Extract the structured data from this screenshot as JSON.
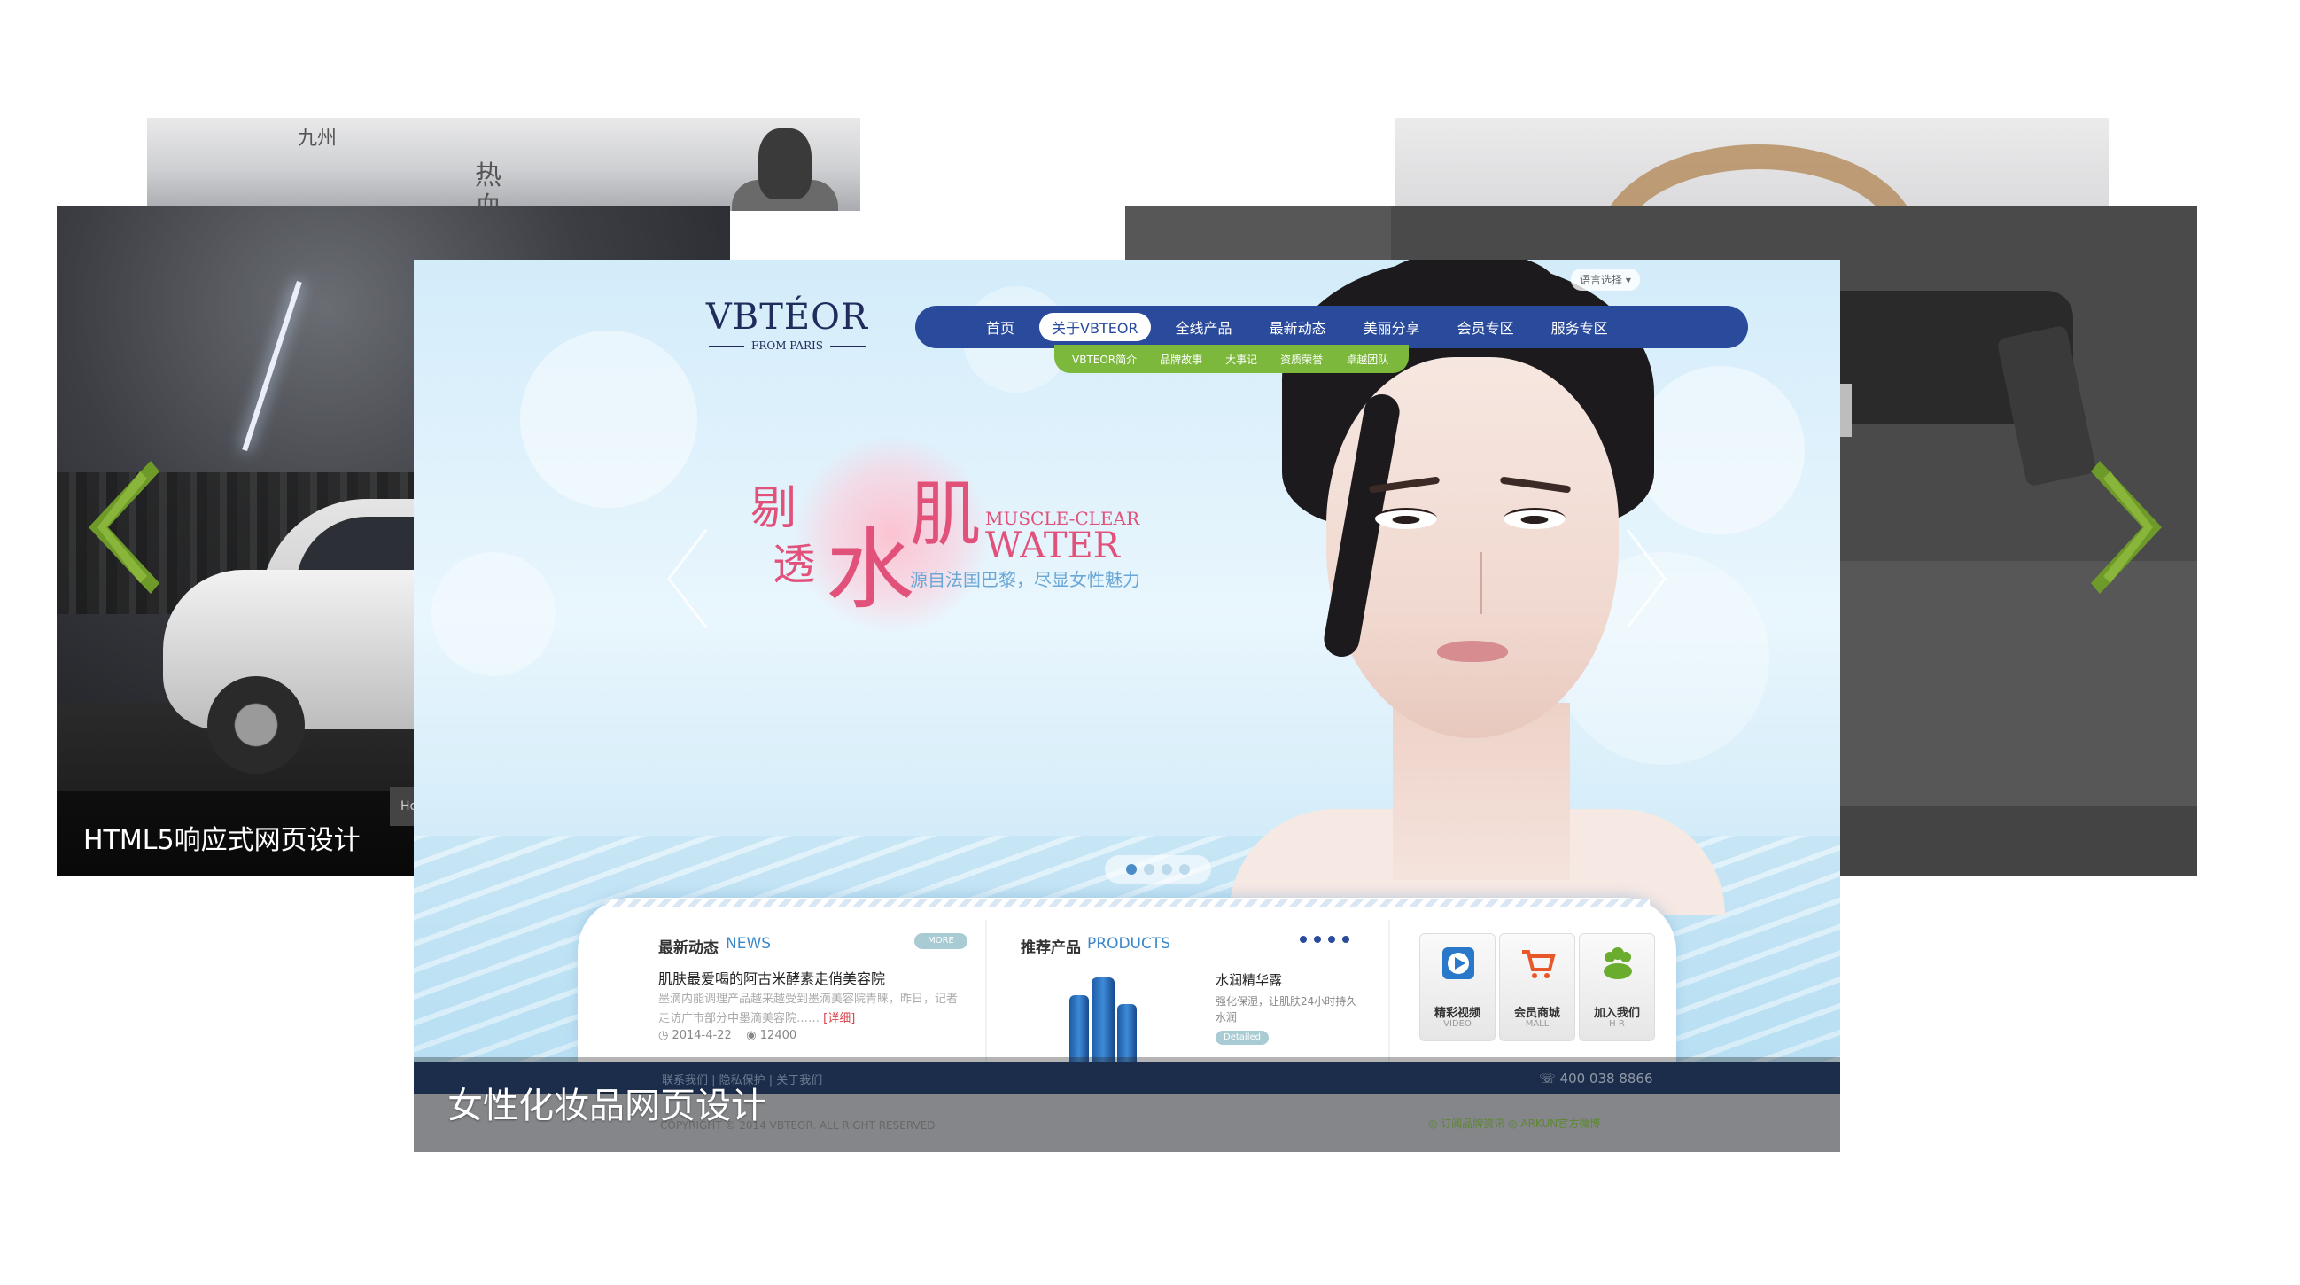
{
  "carousel": {
    "left_caption": "HTML5响应式网页设计",
    "left_small_tab": "Ho",
    "front_caption": "女性化妆品网页设计",
    "arrow_color": "#6e9a2a"
  },
  "back_top_left": {
    "brush_1": "热",
    "brush_2": "血",
    "brush_3": "九州"
  },
  "site": {
    "logo_main": "VBTÉOR",
    "logo_sub": "FROM PARIS",
    "lang_select": "语言选择 ▾",
    "nav": [
      "首页",
      "关于VBTEOR",
      "全线产品",
      "最新动态",
      "美丽分享",
      "会员专区",
      "服务专区"
    ],
    "nav_active_index": 1,
    "subnav": [
      "VBTEOR简介",
      "品牌故事",
      "大事记",
      "资质荣誉",
      "卓越团队"
    ],
    "slogan": {
      "cn_1": "剔",
      "cn_2": "透",
      "cn_water": "水",
      "cn_ji": "肌",
      "en_1": "MUSCLE-CLEAR",
      "en_2": "WATER",
      "sub": "源自法国巴黎，尽显女性魅力"
    },
    "pager_count": 4,
    "pager_active": 0,
    "news": {
      "title_cn": "最新动态",
      "title_en": "NEWS",
      "more": "MORE",
      "headline": "肌肤最爱喝的阿古米酵素走俏美容院",
      "body": "墨滴内能调理产品越来越受到墨滴美容院青睐，昨日，记者走访广市部分中墨滴美容院……",
      "detail": "[详细]",
      "date": "◷ 2014-4-22",
      "views": "◉ 12400"
    },
    "products": {
      "title_cn": "推荐产品",
      "title_en": "PRODUCTS",
      "name": "水润精华露",
      "desc": "强化保湿，让肌肤24小时持久水润",
      "detail": "Detailed"
    },
    "tiles": [
      {
        "label": "精彩视频",
        "sub": "VIDEO",
        "icon": "video-play-icon",
        "color": "#2a78c9"
      },
      {
        "label": "会员商城",
        "sub": "MALL",
        "icon": "shopping-cart-icon",
        "color": "#e8572a"
      },
      {
        "label": "加入我们",
        "sub": "H R",
        "icon": "people-group-icon",
        "color": "#6aac2e"
      }
    ],
    "footer": {
      "links": "联系我们 | 隐私保护 | 关于我们",
      "phone": "☏ 400 038 8866",
      "copyright": "COPYRIGHT © 2014 VBTEOR. ALL RIGHT RESERVED",
      "social": "◎ 订阅品牌资讯    ◎ ARKUN官方微博"
    }
  }
}
